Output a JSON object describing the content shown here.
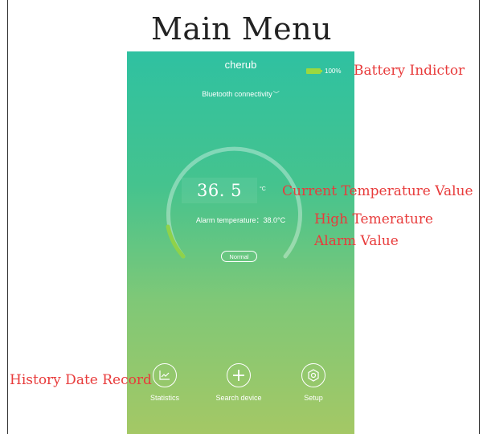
{
  "page": {
    "title": "Main Menu"
  },
  "app": {
    "title": "cherub",
    "battery": {
      "percent_label": "100%",
      "level": 1.0,
      "color": "#9bd83f"
    },
    "bluetooth": {
      "label": "Bluetooth connectivity",
      "icon": "chevron-down-icon"
    },
    "temperature": {
      "value": "36. 5",
      "unit": "°C"
    },
    "alarm": {
      "label": "Alarm temperature：38.0°C"
    },
    "status": {
      "label": "Normal"
    },
    "nav": [
      {
        "label": "Statistics",
        "icon": "chart-icon"
      },
      {
        "label": "Search device",
        "icon": "plus-icon"
      },
      {
        "label": "Setup",
        "icon": "gear-icon"
      }
    ],
    "colors": {
      "gradient_top": "#2fc1a1",
      "gradient_bottom": "#a4c865",
      "gauge_accent": "#8fd24a"
    }
  },
  "annotations": {
    "battery": "Battery Indictor",
    "current_temp": "Current Temperature Value",
    "high_alarm_line1": "High Temerature",
    "high_alarm_line2": "Alarm Value",
    "history": "History Date Record"
  }
}
